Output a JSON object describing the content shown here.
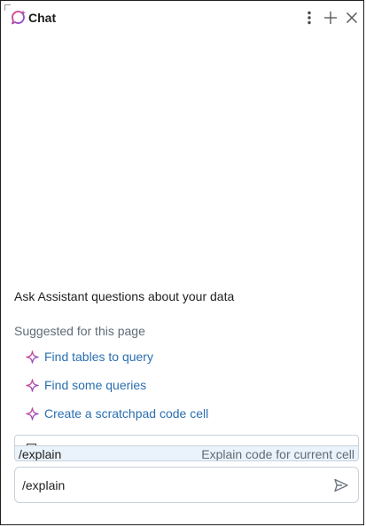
{
  "header": {
    "title": "Chat",
    "icons": {
      "logo": "chat-assistant-icon",
      "more": "kebab-menu-icon",
      "new": "plus-icon",
      "close": "close-icon"
    }
  },
  "main": {
    "intro": "Ask Assistant questions about your data",
    "suggested_title": "Suggested for this page",
    "suggestions": [
      {
        "label": "Find tables to query"
      },
      {
        "label": "Find some queries"
      },
      {
        "label": "Create a scratchpad code cell"
      }
    ]
  },
  "command_menu": {
    "items": [
      {
        "command": "/explain",
        "description": "Explain code for current cell"
      }
    ]
  },
  "input": {
    "value": "/explain"
  },
  "colors": {
    "accent_link": "#2a6fb0",
    "sparkle_start": "#e0457b",
    "sparkle_end": "#7b4ee0",
    "highlight": "#eaf3fb"
  }
}
